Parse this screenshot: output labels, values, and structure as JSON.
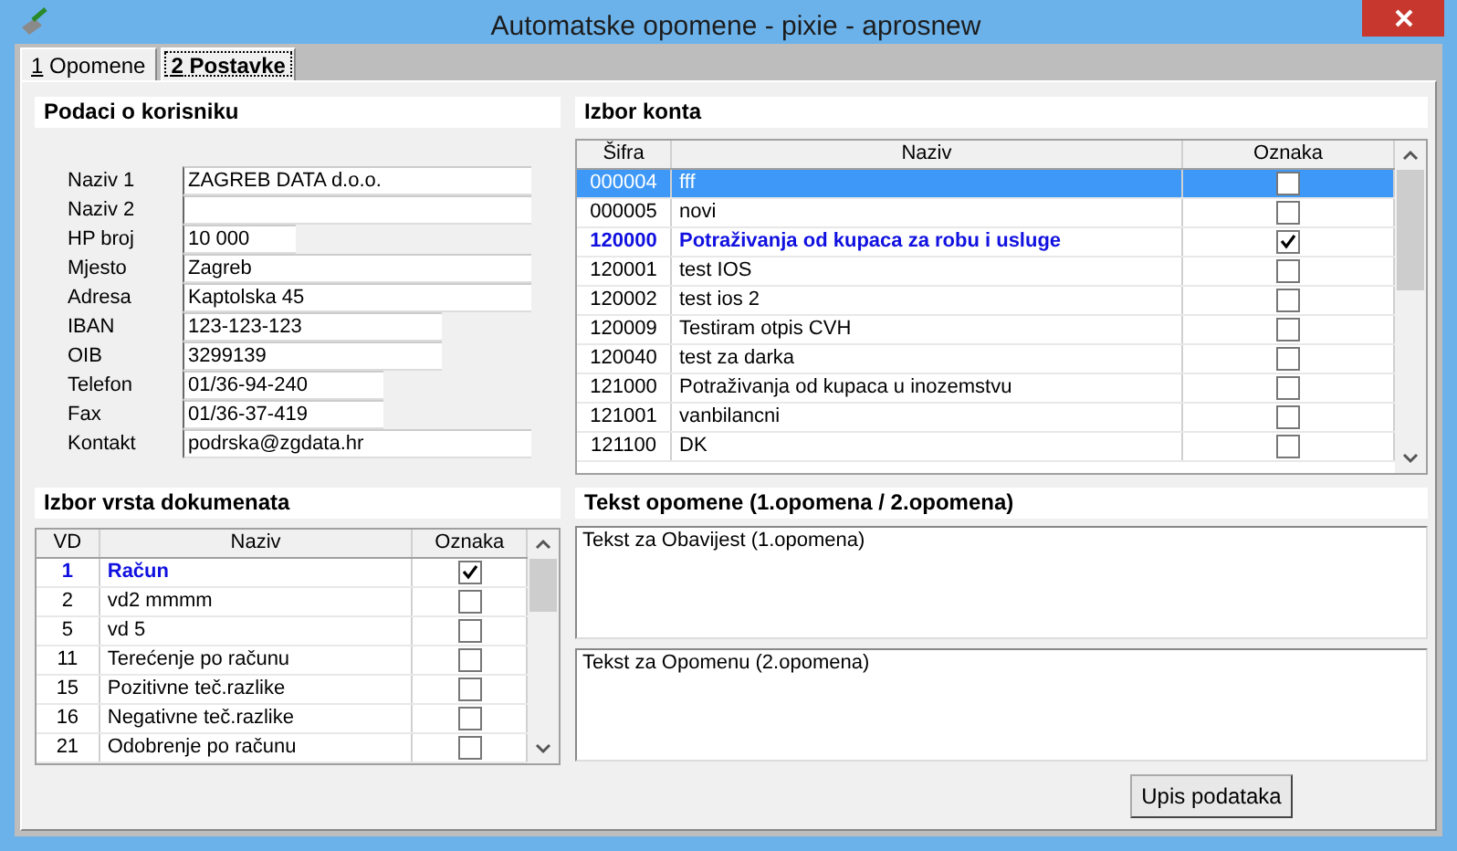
{
  "window": {
    "title": "Automatske opomene - pixie - aprosnew"
  },
  "tabs": [
    {
      "hotkey": "1",
      "label": "Opomene",
      "selected": false
    },
    {
      "hotkey": "2",
      "label": "Postavke",
      "selected": true
    }
  ],
  "user_panel": {
    "title": "Podaci o korisniku",
    "fields": [
      {
        "label": "Naziv 1",
        "value": "ZAGREB DATA d.o.o."
      },
      {
        "label": "Naziv 2"
      },
      {
        "label": "HP broj",
        "value": "10 000"
      },
      {
        "label": "Mjesto",
        "value": "Zagreb"
      },
      {
        "label": "Adresa",
        "value": "Kaptolska 45"
      },
      {
        "label": "IBAN",
        "value": "123-123-123"
      },
      {
        "label": "OIB",
        "value": "3299139"
      },
      {
        "label": "Telefon",
        "value": "01/36-94-240"
      },
      {
        "label": "Fax",
        "value": "01/36-37-419"
      },
      {
        "label": "Kontakt",
        "value": "podrska@zgdata.hr"
      }
    ]
  },
  "accounts": {
    "title": "Izbor konta",
    "columns": [
      "Šifra",
      "Naziv",
      "Oznaka"
    ],
    "rows": [
      {
        "code": "000004",
        "name": "fff",
        "checked": false,
        "selected": true
      },
      {
        "code": "000005",
        "name": "novi",
        "checked": false,
        "selected": false
      },
      {
        "code": "120000",
        "name": "Potraživanja od kupaca za robu i usluge",
        "checked": true,
        "selected": false
      },
      {
        "code": "120001",
        "name": "test IOS",
        "checked": false,
        "selected": false
      },
      {
        "code": "120002",
        "name": "test ios 2",
        "checked": false,
        "selected": false
      },
      {
        "code": "120009",
        "name": "Testiram otpis CVH",
        "checked": false,
        "selected": false
      },
      {
        "code": "120040",
        "name": "test za darka",
        "checked": false,
        "selected": false
      },
      {
        "code": "121000",
        "name": "Potraživanja od kupaca u inozemstvu",
        "checked": false,
        "selected": false
      },
      {
        "code": "121001",
        "name": "vanbilancni",
        "checked": false,
        "selected": false
      },
      {
        "code": "121100",
        "name": "DK",
        "checked": false,
        "selected": false
      }
    ]
  },
  "document_types": {
    "title": "Izbor vrsta dokumenata",
    "columns": [
      "VD",
      "Naziv",
      "Oznaka"
    ],
    "rows": [
      {
        "code": "1",
        "name": "Račun",
        "checked": true,
        "selected": false
      },
      {
        "code": "2",
        "name": "vd2 mmmm",
        "checked": false,
        "selected": false
      },
      {
        "code": "5",
        "name": "vd 5",
        "checked": false,
        "selected": false
      },
      {
        "code": "11",
        "name": "Terećenje po računu",
        "checked": false,
        "selected": false
      },
      {
        "code": "15",
        "name": "Pozitivne teč.razlike",
        "checked": false,
        "selected": false
      },
      {
        "code": "16",
        "name": "Negativne teč.razlike",
        "checked": false,
        "selected": false
      },
      {
        "code": "21",
        "name": "Odobrenje po računu",
        "checked": false,
        "selected": false
      }
    ]
  },
  "reminder_text": {
    "title": "Tekst opomene (1.opomena / 2.opomena)",
    "texts": [
      "Tekst za Obavijest (1.opomena)",
      "Tekst za Opomenu (2.opomena)"
    ]
  },
  "buttons": [
    "Upis podataka"
  ]
}
